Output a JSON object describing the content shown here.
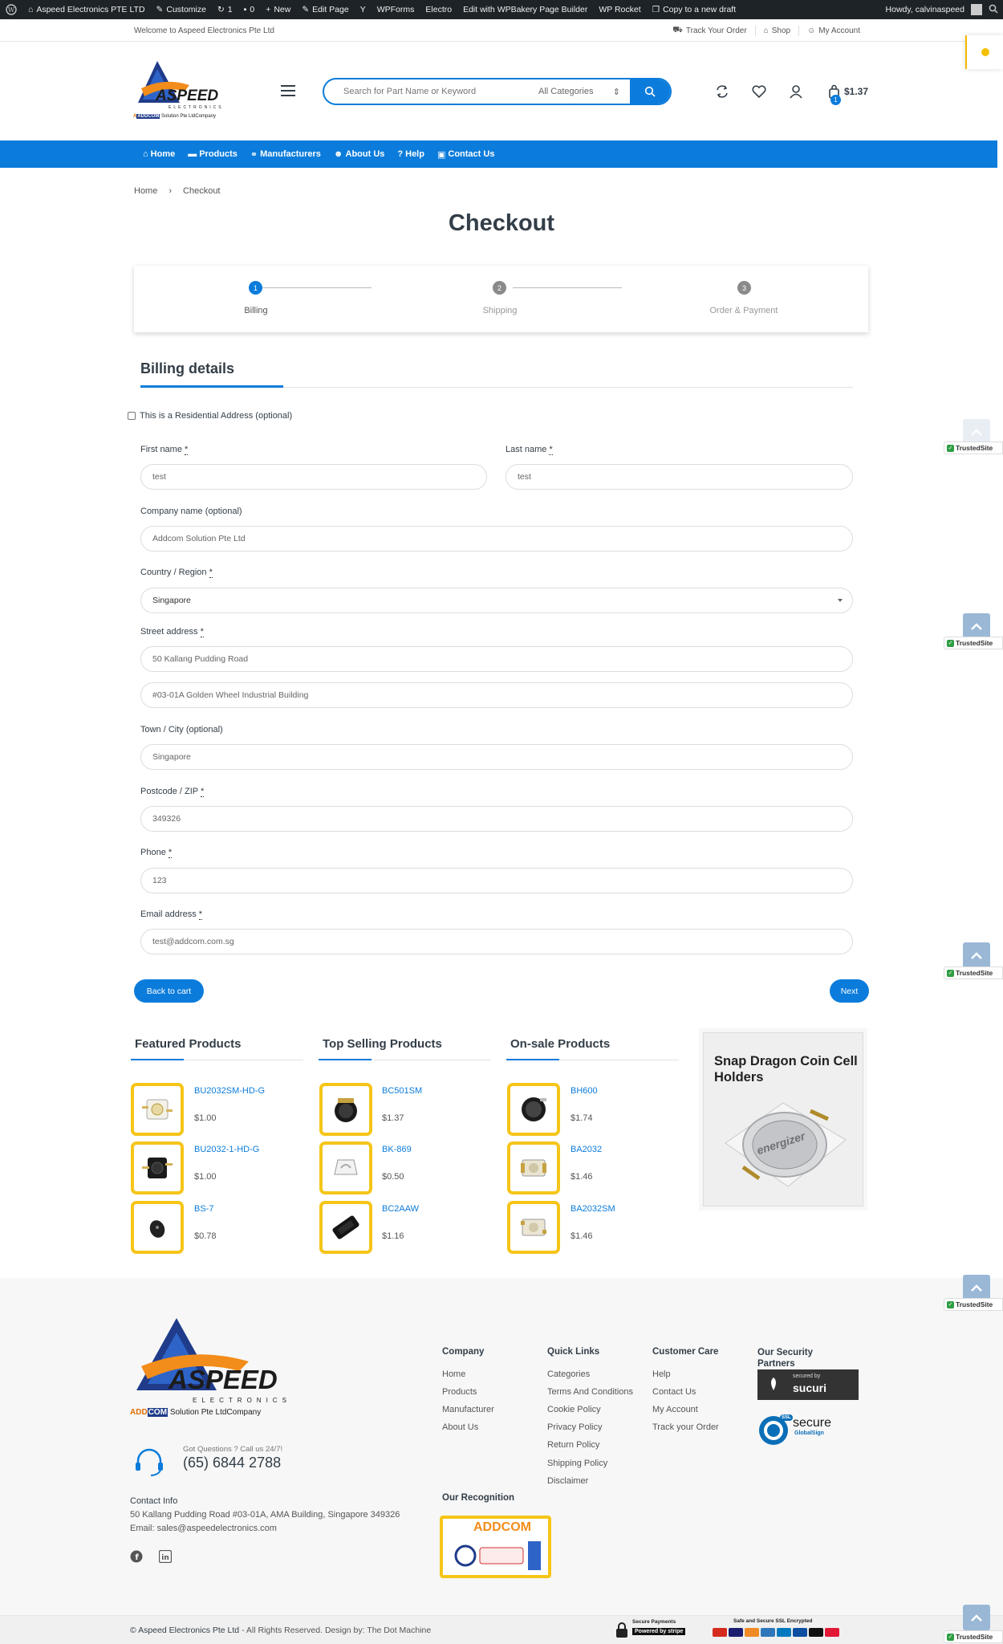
{
  "adminbar": {
    "site_name": "Aspeed Electronics PTE LTD",
    "customize": "Customize",
    "updates_count": "1",
    "comments_count": "0",
    "new": "New",
    "edit_page": "Edit Page",
    "wpforms": "WPForms",
    "electro": "Electro",
    "wpbakery": "Edit with WPBakery Page Builder",
    "wp_rocket": "WP Rocket",
    "copy_draft": "Copy to a new draft",
    "howdy": "Howdy, calvinaspeed"
  },
  "topstrip": {
    "welcome": "Welcome to Aspeed Electronics Pte Ltd",
    "track_order": "Track Your Order",
    "shop": "Shop",
    "my_account": "My Account"
  },
  "header": {
    "logo_text": "ASPEED",
    "logo_sub": "ELECTRONICS",
    "logo_tag_prefix": "A",
    "logo_tag_brand": "ADDCOM",
    "logo_tag_suffix": "Solution Pte LtdCompany",
    "search_placeholder": "Search for Part Name or Keyword",
    "search_category": "All Categories",
    "cart_total": "$1.37",
    "cart_count": "1"
  },
  "nav": {
    "items": [
      {
        "label": "Home",
        "icon": "home-icon"
      },
      {
        "label": "Products",
        "icon": "products-icon"
      },
      {
        "label": "Manufacturers",
        "icon": "handshake-icon"
      },
      {
        "label": "About Us",
        "icon": "users-icon"
      },
      {
        "label": "Help",
        "icon": "question-icon"
      },
      {
        "label": "Contact Us",
        "icon": "contact-icon"
      }
    ]
  },
  "breadcrumb": {
    "home": "Home",
    "separator": "›",
    "current": "Checkout"
  },
  "page_title": "Checkout",
  "stepper": {
    "steps": [
      {
        "number": "1",
        "label": "Billing",
        "active": true
      },
      {
        "number": "2",
        "label": "Shipping",
        "active": false
      },
      {
        "number": "3",
        "label": "Order & Payment",
        "active": false
      }
    ]
  },
  "billing": {
    "title": "Billing details",
    "residential_label": "This is a Residential Address (optional)",
    "required_mark": "*",
    "first_name_label": "First name",
    "first_name_value": "test",
    "last_name_label": "Last name",
    "last_name_value": "test",
    "company_label": "Company name (optional)",
    "company_value": "Addcom Solution Pte Ltd",
    "country_label": "Country / Region",
    "country_value": "Singapore",
    "street_label": "Street address",
    "street1_value": "50 Kallang Pudding Road",
    "street2_value": "#03-01A Golden Wheel Industrial Building",
    "town_label": "Town / City (optional)",
    "town_value": "Singapore",
    "postcode_label": "Postcode / ZIP",
    "postcode_value": "349326",
    "phone_label": "Phone",
    "phone_value": "123",
    "email_label": "Email address",
    "email_value": "test@addcom.com.sg",
    "back_button": "Back to cart",
    "next_button": "Next"
  },
  "widgets": {
    "featured": {
      "title": "Featured Products",
      "items": [
        {
          "name": "BU2032SM-HD-G",
          "price": "$1.00"
        },
        {
          "name": "BU2032-1-HD-G",
          "price": "$1.00"
        },
        {
          "name": "BS-7",
          "price": "$0.78"
        }
      ]
    },
    "top_selling": {
      "title": "Top Selling Products",
      "items": [
        {
          "name": "BC501SM",
          "price": "$1.37"
        },
        {
          "name": "BK-869",
          "price": "$0.50"
        },
        {
          "name": "BC2AAW",
          "price": "$1.16"
        }
      ]
    },
    "on_sale": {
      "title": "On-sale Products",
      "items": [
        {
          "name": "BH600",
          "price": "$1.74"
        },
        {
          "name": "BA2032",
          "price": "$1.46"
        },
        {
          "name": "BA2032SM",
          "price": "$1.46"
        }
      ]
    },
    "promo": {
      "title": "Snap Dragon Coin Cell Holders",
      "battery_text": "energizer"
    }
  },
  "trusted": {
    "label": "TrustedSite"
  },
  "footer": {
    "questions": "Got Questions ? Call us 24/7!",
    "phone": "(65) 6844 2788",
    "contact_title": "Contact Info",
    "address": "50 Kallang Pudding Road #03-01A, AMA Building, Singapore 349326",
    "email": "Email: sales@aspeedelectronics.com",
    "company": {
      "title": "Company",
      "links": [
        "Home",
        "Products",
        "Manufacturer",
        "About Us"
      ]
    },
    "quick_links": {
      "title": "Quick Links",
      "links": [
        "Categories",
        "Terms And Conditions",
        "Cookie Policy",
        "Privacy Policy",
        "Return Policy",
        "Shipping Policy",
        "Disclaimer"
      ]
    },
    "customer_care": {
      "title": "Customer Care",
      "links": [
        "Help",
        "Contact Us",
        "My Account",
        "Track your Order"
      ]
    },
    "security": {
      "title": "Our Security Partners",
      "sucuri_small": "secured by",
      "sucuri": "sucuri",
      "secure_big": "secure",
      "globalsign": "GlobalSign",
      "ssl": "SSL"
    },
    "recognition_title": "Our Recognition",
    "recognition_brand": "ADDCOM",
    "copyright_brand": "© Aspeed Electronics Pte Ltd",
    "copyright_rest": " - All Rights Reserved. Design by: The Dot Machine",
    "payments_secure": "Secure Payments",
    "payments_powered": "Powered by stripe",
    "payments_ssl": "Safe and Secure SSL Encrypted"
  },
  "colors": {
    "accent": "#0b7cdb",
    "gold": "#f5c518",
    "text": "#333e48"
  }
}
